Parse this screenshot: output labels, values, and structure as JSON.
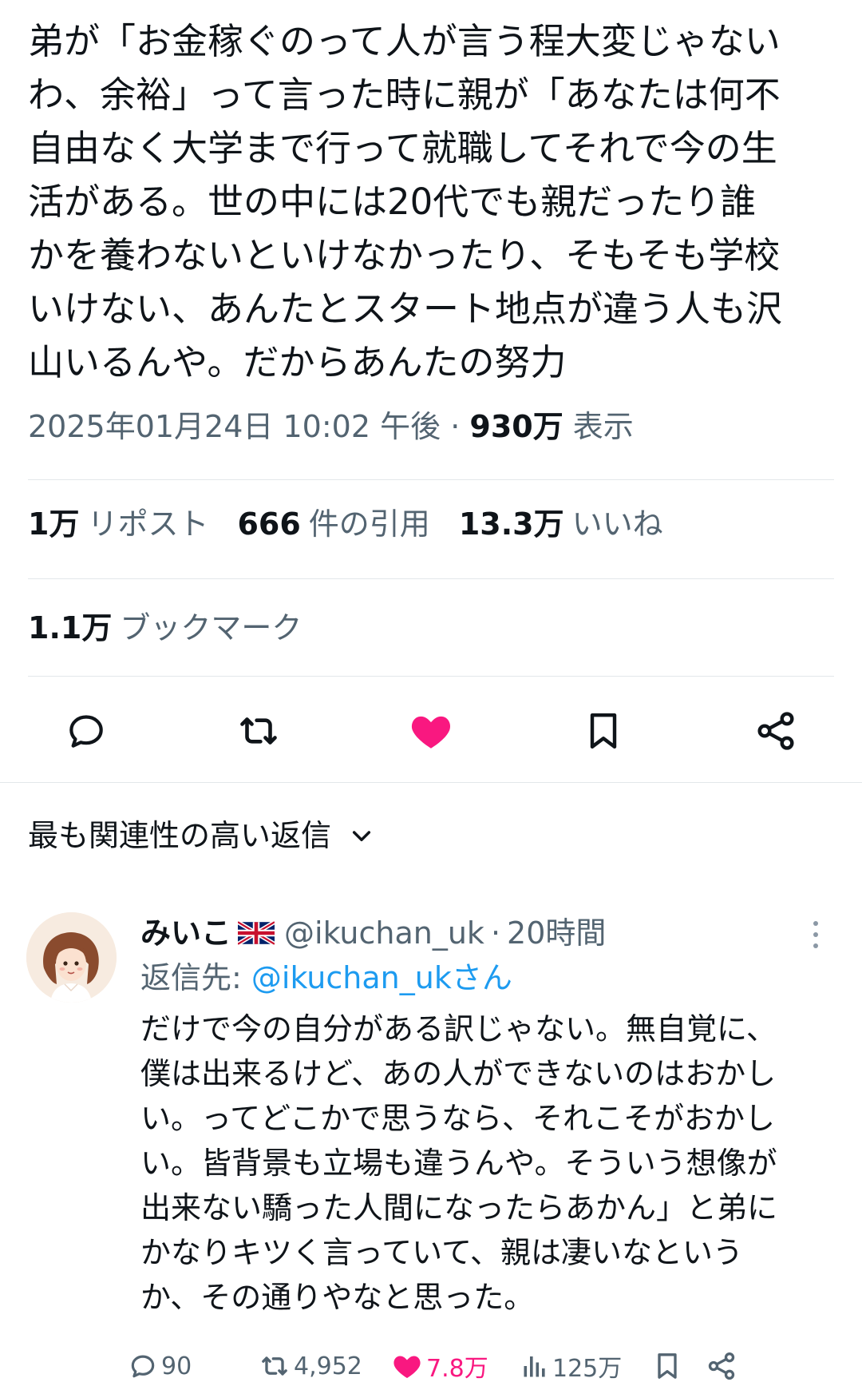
{
  "tweet": {
    "text": "弟が「お金稼ぐのって人が言う程大変じゃない\nわ、余裕」って言った時に親が「あなたは何不\n自由なく大学まで行って就職してそれで今の生\n活がある。世の中には20代でも親だったり誰\nかを養わないといけなかったり、そもそも学校\nいけない、あんたとスタート地点が違う人も沢\n山いるんや。だからあんたの努力",
    "timestamp": "2025年01月24日 10:02 午後",
    "separator": "·",
    "views_count": "930万",
    "views_label": "表示"
  },
  "stats": {
    "reposts_count": "1万",
    "reposts_label": "リポスト",
    "quotes_count": "666",
    "quotes_label": "件の引用",
    "likes_count": "13.3万",
    "likes_label": "いいね",
    "bookmarks_count": "1.1万",
    "bookmarks_label": "ブックマーク"
  },
  "actions": {
    "icons": [
      "reply-icon",
      "retweet-icon",
      "heart-icon",
      "bookmark-icon",
      "share-icon"
    ],
    "liked_color": "#f91880"
  },
  "replies_sort": {
    "label": "最も関連性の高い返信"
  },
  "reply": {
    "display_name": "みいこ",
    "handle": "@ikuchan_uk",
    "separator": "·",
    "time": "20時間",
    "reply_to_label": "返信先:",
    "reply_to_mention": "@ikuchan_ukさん",
    "text": "だけで今の自分がある訳じゃない。無自覚に、\n僕は出来るけど、あの人ができないのはおかし\nい。ってどこかで思うなら、それこそがおかし\nい。皆背景も立場も違うんや。そういう想像が\n出来ない驕った人間になったらあかん」と弟に\nかなりキツく言っていて、親は凄いなという\nか、その通りやなと思った。",
    "replies": "90",
    "retweets": "4,952",
    "likes": "7.8万",
    "views": "125万"
  },
  "colors": {
    "text": "#0f1419",
    "secondary": "#536471",
    "link": "#1d9bf0",
    "like": "#f91880",
    "divider": "#e3e7ea"
  }
}
